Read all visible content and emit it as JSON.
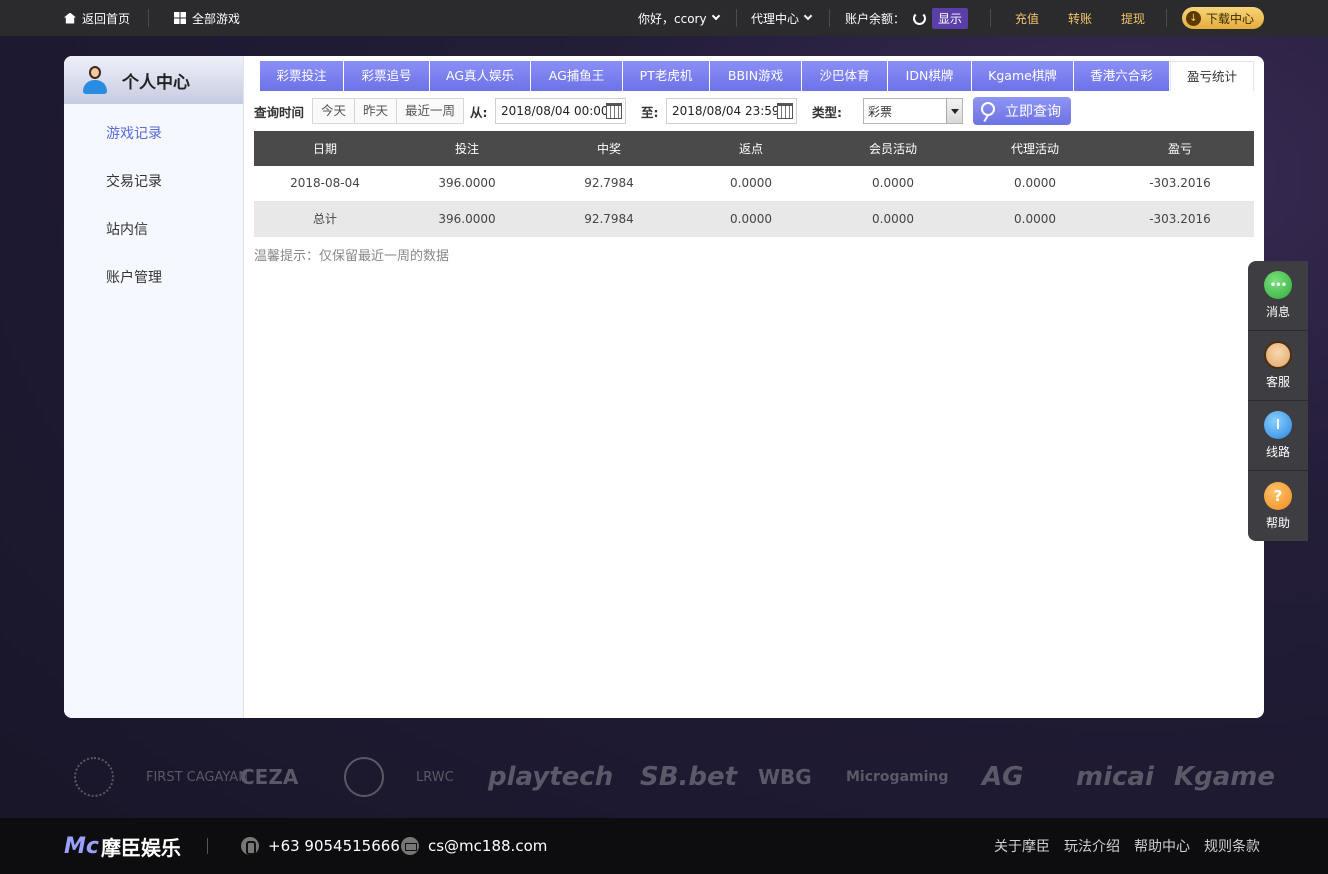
{
  "topbar": {
    "home_label": "返回首页",
    "all_games_label": "全部游戏",
    "greeting": "你好，ccory",
    "agent_center": "代理中心",
    "balance_label": "账户余额：",
    "show_label": "显示",
    "recharge": "充值",
    "transfer": "转账",
    "withdraw": "提现",
    "download": "下载中心"
  },
  "sidebar": {
    "title": "个人中心",
    "items": [
      {
        "label": "游戏记录",
        "active": true
      },
      {
        "label": "交易记录",
        "active": false
      },
      {
        "label": "站内信",
        "active": false
      },
      {
        "label": "账户管理",
        "active": false
      }
    ]
  },
  "tabs": [
    {
      "label": "彩票投注",
      "active": false
    },
    {
      "label": "彩票追号",
      "active": false
    },
    {
      "label": "AG真人娱乐",
      "active": false
    },
    {
      "label": "AG捕鱼王",
      "active": false
    },
    {
      "label": "PT老虎机",
      "active": false
    },
    {
      "label": "BBIN游戏",
      "active": false
    },
    {
      "label": "沙巴体育",
      "active": false
    },
    {
      "label": "IDN棋牌",
      "active": false
    },
    {
      "label": "Kgame棋牌",
      "active": false
    },
    {
      "label": "香港六合彩",
      "active": false
    },
    {
      "label": "盈亏统计",
      "active": true
    }
  ],
  "query": {
    "time_label": "查询时间",
    "ranges": [
      "今天",
      "昨天",
      "最近一周"
    ],
    "from_label": "从:",
    "from_value": "2018/08/04 00:00",
    "to_label": "至:",
    "to_value": "2018/08/04 23:59",
    "type_label": "类型:",
    "type_value": "彩票",
    "search_label": "立即查询"
  },
  "table": {
    "headers": [
      "日期",
      "投注",
      "中奖",
      "返点",
      "会员活动",
      "代理活动",
      "盈亏"
    ],
    "rows": [
      [
        "2018-08-04",
        "396.0000",
        "92.7984",
        "0.0000",
        "0.0000",
        "0.0000",
        "-303.2016"
      ]
    ],
    "total": [
      "总计",
      "396.0000",
      "92.7984",
      "0.0000",
      "0.0000",
      "0.0000",
      "-303.2016"
    ]
  },
  "tip": "温馨提示：仅保留最近一周的数据",
  "floatbar": [
    {
      "label": "消息",
      "icon": "message-icon"
    },
    {
      "label": "客服",
      "icon": "customer-service-icon"
    },
    {
      "label": "线路",
      "icon": "route-icon"
    },
    {
      "label": "帮助",
      "icon": "help-icon"
    }
  ],
  "logos": [
    "CEZA",
    "playtech",
    "SB.bet",
    "WBG",
    "Microgaming",
    "AG",
    "micai",
    "Kgame",
    "FIRST CAGAYAN",
    "LRWC"
  ],
  "footer": {
    "brand_mark": "Mc",
    "brand_name": "摩臣娱乐",
    "phone": "+63 9054515666",
    "email": "cs@mc188.com",
    "links": [
      "关于摩臣",
      "玩法介绍",
      "帮助中心",
      "规则条款"
    ]
  },
  "colors": {
    "accent": "#6d72e8",
    "topbar": "#2b2b2e",
    "gold": "#f2c46a",
    "table_header": "#4a4a4a"
  }
}
